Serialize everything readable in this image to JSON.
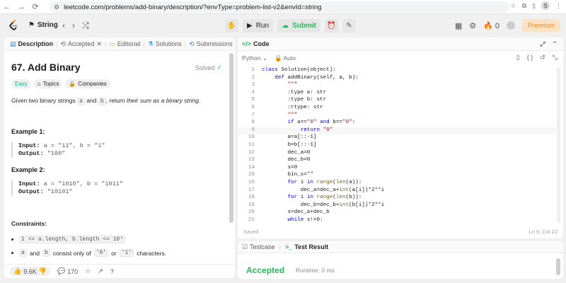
{
  "browser": {
    "url": "leetcode.com/problems/add-binary/description/?envType=problem-list-v2&envId=string",
    "profile_initial": "S"
  },
  "topbar": {
    "study_label": "String",
    "run_label": "Run",
    "submit_label": "Submit",
    "points": "0",
    "premium_label": "Premium"
  },
  "left_tabs": [
    {
      "label": "Description"
    },
    {
      "label": "Accepted"
    },
    {
      "label": "Editorial"
    },
    {
      "label": "Solutions"
    },
    {
      "label": "Submissions"
    }
  ],
  "problem": {
    "title": "67. Add Binary",
    "status": "Solved",
    "tags": [
      "Easy",
      "Topics",
      "Companies"
    ],
    "desc_pre": "Given two binary strings",
    "var_a": "a",
    "desc_and": "and",
    "var_b": "b",
    "desc_mid": ", return",
    "desc_em": "their sum as a binary string",
    "desc_end": "."
  },
  "examples": [
    {
      "title": "Example 1:",
      "input_label": "Input:",
      "input_value": "a = \"11\", b = \"1\"",
      "output_label": "Output:",
      "output_value": "\"100\""
    },
    {
      "title": "Example 2:",
      "input_label": "Input:",
      "input_value": "a = \"1010\", b = \"1011\"",
      "output_label": "Output:",
      "output_value": "\"10101\""
    }
  ],
  "constraints": {
    "title": "Constraints:",
    "c1": "1 <= a.length, b.length <= 10⁴",
    "c2_a": "a",
    "c2_and": "and",
    "c2_b": "b",
    "c2_mid": "consist only of",
    "c2_0": "'0'",
    "c2_or": "or",
    "c2_1": "'1'",
    "c2_end": "characters."
  },
  "left_footer": {
    "likes": "9.6K",
    "comments": "170"
  },
  "code_panel": {
    "title": "Code",
    "language": "Python",
    "mode": "Auto",
    "saved": "Saved",
    "cursor": "Ln 9, Col 22"
  },
  "code_lines": [
    "class Solution(object):",
    "    def addBinary(self, a, b):",
    "        \"\"\"",
    "        :type a: str",
    "        :type b: str",
    "        :rtype: str",
    "        \"\"\"",
    "        if a==\"0\" and b==\"0\":",
    "            return \"0\"",
    "        a=a[::-1]",
    "        b=b[::-1]",
    "        dec_a=0",
    "        dec_b=0",
    "        s=0",
    "        bin_s=\"\"",
    "        for i in range(len(a)):",
    "            dec_a=dec_a+int(a[i])*2**i",
    "        for i in range(len(b)):",
    "            dec_b=dec_b+int(b[i])*2**i",
    "        s=dec_a+dec_b",
    "        while s!=0:"
  ],
  "result": {
    "testcase_tab": "Testcase",
    "result_tab": "Test Result",
    "status": "Accepted",
    "runtime": "Runtime: 0 ms"
  }
}
